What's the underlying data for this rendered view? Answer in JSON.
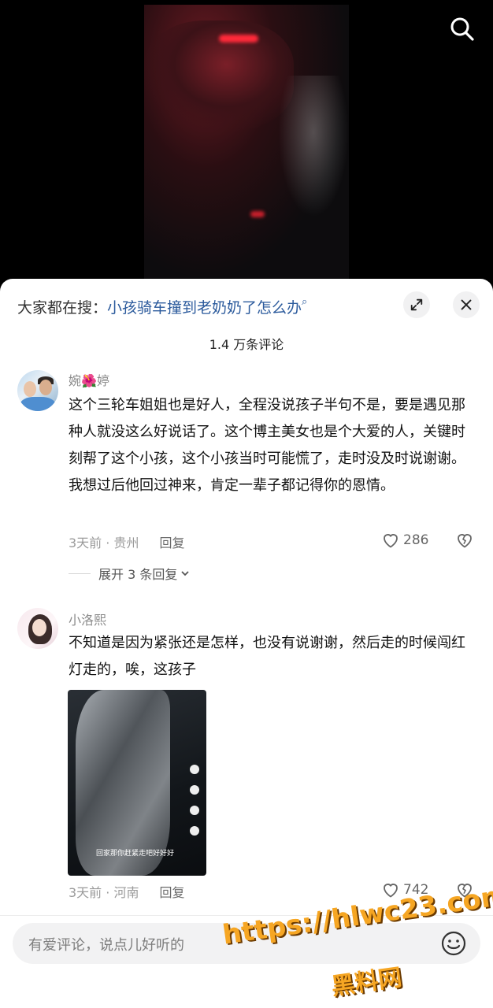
{
  "video": {
    "search_icon": "search-icon"
  },
  "sheet": {
    "search_prefix": "大家都在搜：",
    "search_query": "小孩骑车撞到老奶奶了怎么办",
    "expand_icon": "expand-icon",
    "close_icon": "close-icon",
    "comment_count": "1.4 万条评论"
  },
  "comments": [
    {
      "username_pre": "婉",
      "username_flower": "🌺",
      "username_post": "婷",
      "text": "这个三轮车姐姐也是好人，全程没说孩子半句不是，要是遇见那种人就没这么好说话了。这个博主美女也是个大爱的人，关键时刻帮了这个小孩，这个小孩当时可能慌了，走时没及时说谢谢。我想过后他回过神来，肯定一辈子都记得你的恩情。",
      "meta": "3天前 · 贵州",
      "reply": "回复",
      "likes": "286",
      "expand": "展开 3 条回复"
    },
    {
      "username": "小洛熙",
      "text": "不知道是因为紧张还是怎样，也没有说谢谢，然后走的时候闯红灯走的，唉，这孩子",
      "image_caption": "回家那你赶紧走吧好好好",
      "meta": "3天前 · 河南",
      "reply": "回复",
      "likes": "742"
    }
  ],
  "input": {
    "placeholder": "有爱评论，说点儿好听的",
    "emoji_icon": "emoji-icon"
  },
  "watermark": {
    "url": "https://hlwc23.com",
    "name": "黑料网"
  }
}
